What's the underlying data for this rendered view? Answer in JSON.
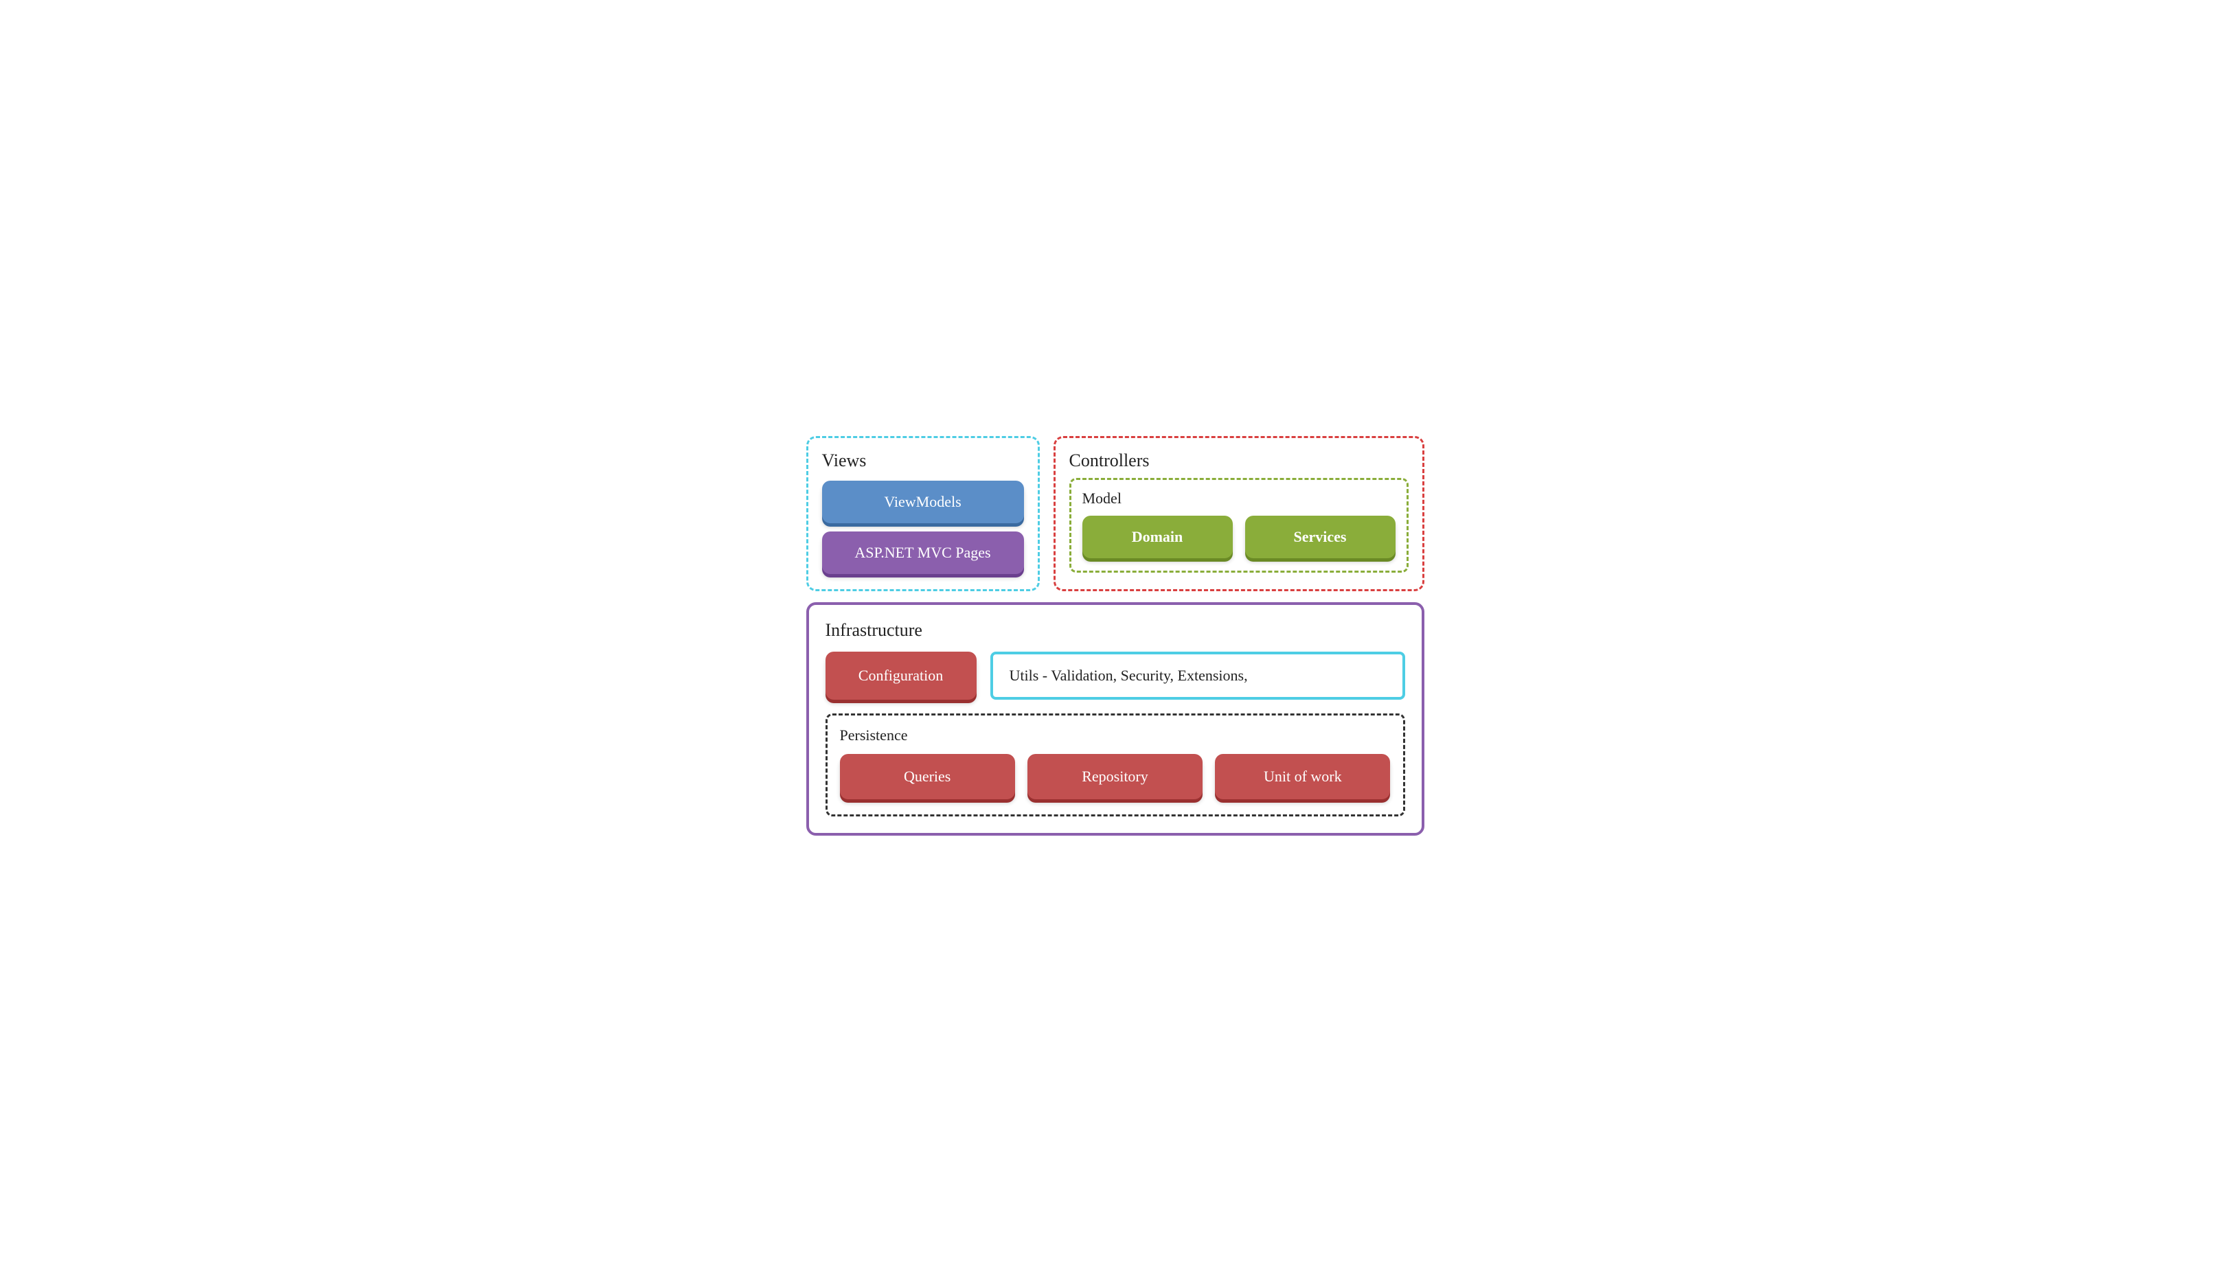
{
  "views": {
    "title": "Views",
    "viewmodels_label": "ViewModels",
    "aspnet_label": "ASP.NET MVC Pages"
  },
  "controllers": {
    "title": "Controllers"
  },
  "model": {
    "title": "Model",
    "domain_label": "Domain",
    "services_label": "Services"
  },
  "infrastructure": {
    "title": "Infrastructure",
    "config_label": "Configuration",
    "utils_label": "Utils - Validation, Security, Extensions,"
  },
  "persistence": {
    "title": "Persistence",
    "queries_label": "Queries",
    "repository_label": "Repository",
    "unitofwork_label": "Unit of work"
  }
}
